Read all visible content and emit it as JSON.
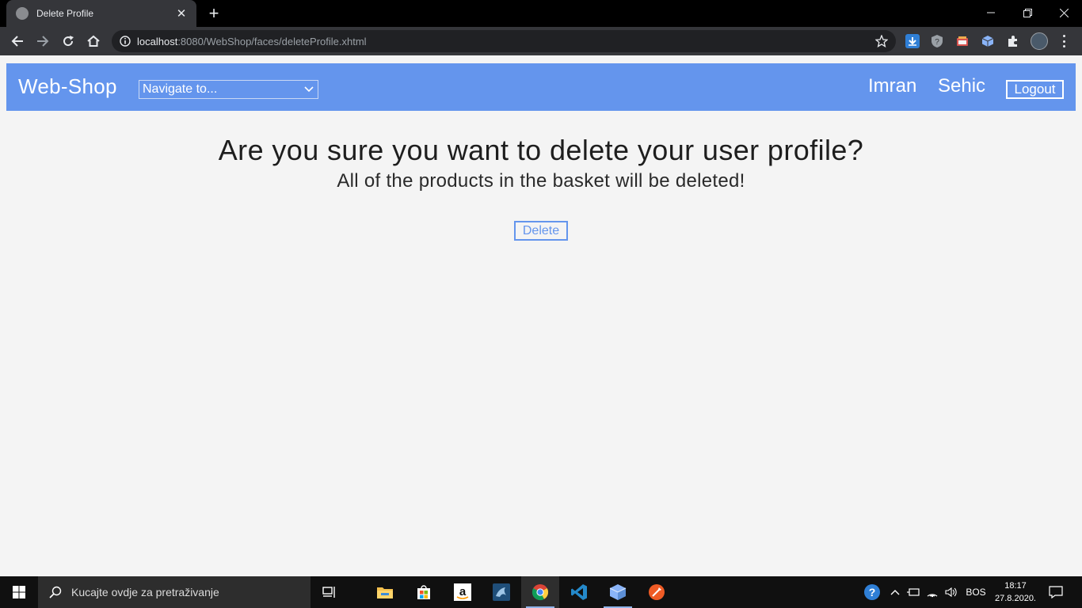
{
  "browser": {
    "tab_title": "Delete Profile",
    "tab_close": "✕",
    "new_tab": "+",
    "url_host": "localhost",
    "url_path": ":8080/WebShop/faces/deleteProfile.xhtml"
  },
  "site": {
    "brand": "Web-Shop",
    "nav_select_value": "Navigate to...",
    "user_first": "Imran",
    "user_last": "Sehic",
    "logout_label": "Logout",
    "accent_color": "#6495ed"
  },
  "content": {
    "heading": "Are you sure you want to delete your user profile?",
    "subheading": "All of the products in the basket will be deleted!",
    "delete_label": "Delete"
  },
  "taskbar": {
    "search_placeholder": "Kucajte ovdje za pretraživanje",
    "language": "BOS",
    "time": "18:17",
    "date": "27.8.2020."
  }
}
